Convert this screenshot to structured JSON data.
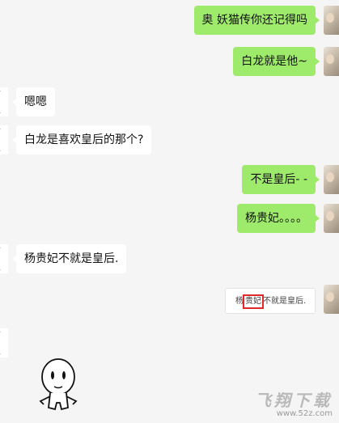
{
  "messages": [
    {
      "from": "me",
      "text": "奥 妖猫传你还记得吗"
    },
    {
      "from": "me",
      "text": "白龙就是他~"
    },
    {
      "from": "them",
      "text": "嗯嗯"
    },
    {
      "from": "them",
      "text": "白龙是喜欢皇后的那个?"
    },
    {
      "from": "me",
      "text": "不是皇后- -"
    },
    {
      "from": "me",
      "text": "杨贵妃。。。。"
    },
    {
      "from": "them",
      "text": "杨贵妃不就是皇后."
    }
  ],
  "screenshot_reply": {
    "before": "杨",
    "highlight": "贵妃",
    "after": "不就是皇后."
  },
  "watermark": {
    "title": "飞翔下载",
    "url": "www.52z.com"
  },
  "colors": {
    "me_bubble": "#9eea6a",
    "them_bubble": "#ffffff",
    "background": "#f5f5f5",
    "highlight_box": "#e02a2a"
  }
}
